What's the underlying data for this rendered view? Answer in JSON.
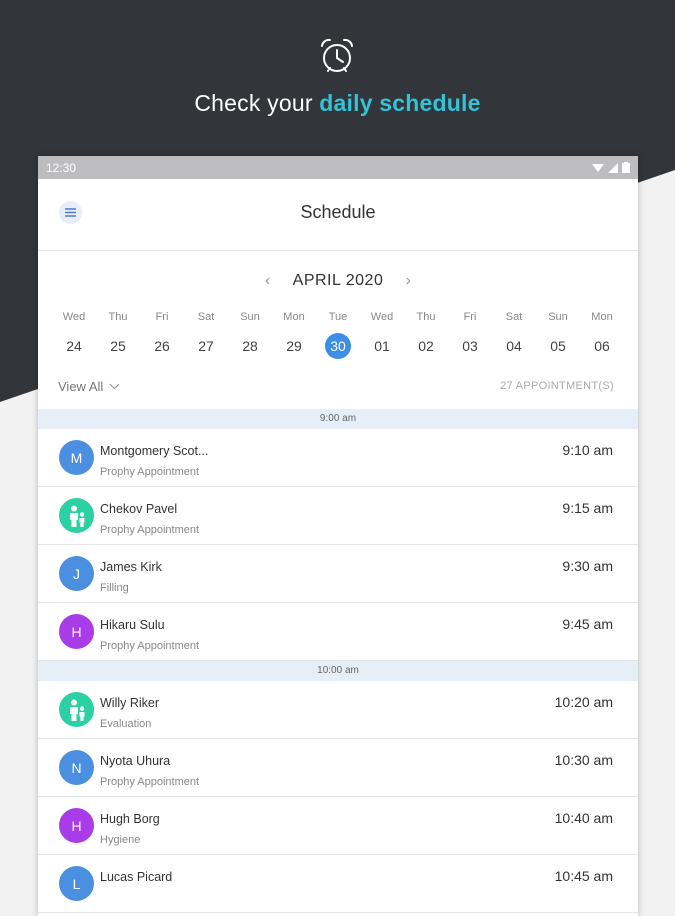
{
  "hero": {
    "title_prefix": "Check your ",
    "title_accent": "daily schedule",
    "icon": "alarm-clock-icon"
  },
  "status_bar": {
    "time": "12:30"
  },
  "app_bar": {
    "title": "Schedule",
    "menu_icon": "menu-icon"
  },
  "calendar": {
    "month_label": "APRIL 2020",
    "days": [
      {
        "dow": "Wed",
        "num": "24"
      },
      {
        "dow": "Thu",
        "num": "25"
      },
      {
        "dow": "Fri",
        "num": "26"
      },
      {
        "dow": "Sat",
        "num": "27"
      },
      {
        "dow": "Sun",
        "num": "28"
      },
      {
        "dow": "Mon",
        "num": "29"
      },
      {
        "dow": "Tue",
        "num": "30",
        "selected": true
      },
      {
        "dow": "Wed",
        "num": "01"
      },
      {
        "dow": "Thu",
        "num": "02"
      },
      {
        "dow": "Fri",
        "num": "03"
      },
      {
        "dow": "Sat",
        "num": "04"
      },
      {
        "dow": "Sun",
        "num": "05"
      },
      {
        "dow": "Mon",
        "num": "06"
      }
    ]
  },
  "filter": {
    "view_all_label": "View All",
    "count_label": "27 APPOINTMENT(S)"
  },
  "sections": [
    {
      "time": "9:00 am",
      "items": [
        {
          "initial": "M",
          "color": "#4a8fe0",
          "name": "Montgomery Scot...",
          "type": "Prophy Appointment",
          "time": "9:10 am"
        },
        {
          "initial": "",
          "icon": "family-icon",
          "color": "#2ad1a3",
          "name": "Chekov Pavel",
          "type": "Prophy Appointment",
          "time": "9:15 am"
        },
        {
          "initial": "J",
          "color": "#4a8fe0",
          "name": "James Kirk",
          "type": "Filling",
          "time": "9:30 am"
        },
        {
          "initial": "H",
          "color": "#a73ce8",
          "name": "Hikaru Sulu",
          "type": "Prophy Appointment",
          "time": "9:45 am"
        }
      ]
    },
    {
      "time": "10:00 am",
      "items": [
        {
          "initial": "",
          "icon": "family-icon",
          "color": "#2ad1a3",
          "name": "Willy Riker",
          "type": "Evaluation",
          "time": "10:20 am"
        },
        {
          "initial": "N",
          "color": "#4a8fe0",
          "name": "Nyota Uhura",
          "type": "Prophy Appointment",
          "time": "10:30 am"
        },
        {
          "initial": "H",
          "color": "#a73ce8",
          "name": "Hugh Borg",
          "type": "Hygiene",
          "time": "10:40 am"
        },
        {
          "initial": "L",
          "color": "#4a8fe0",
          "name": "Lucas Picard",
          "type": "",
          "time": "10:45 am"
        }
      ]
    }
  ]
}
